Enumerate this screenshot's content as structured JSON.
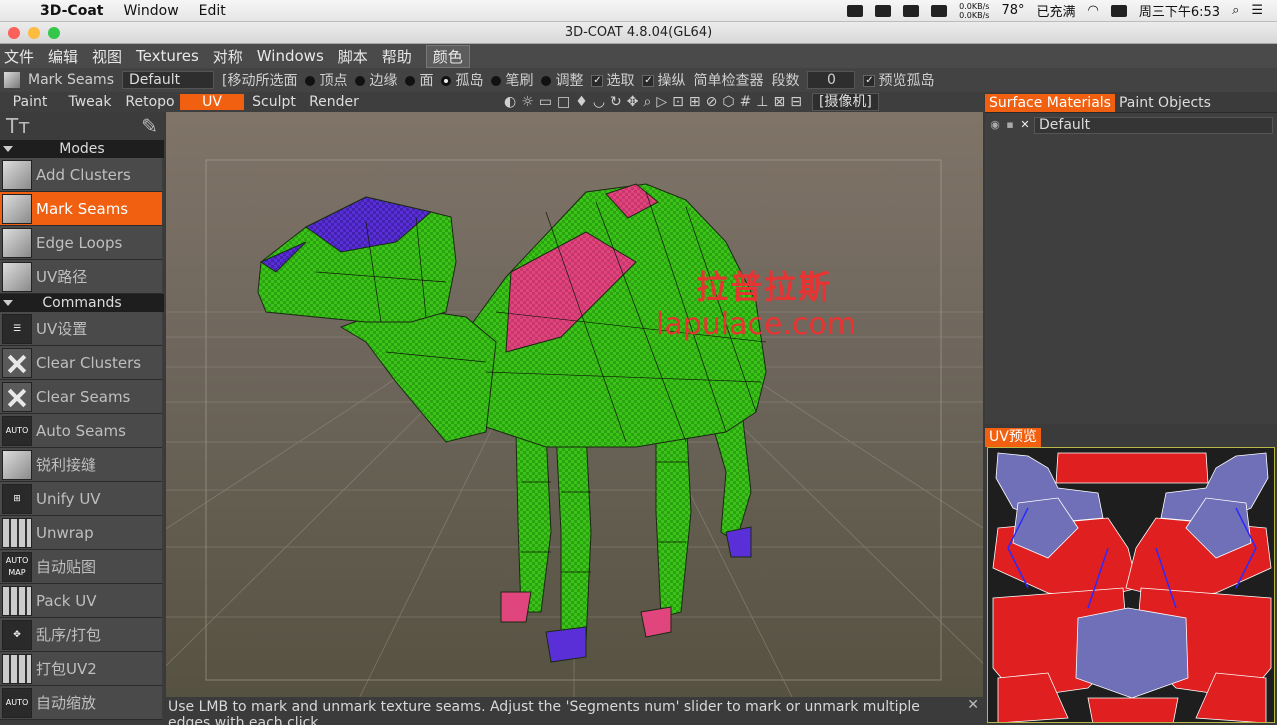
{
  "mac": {
    "app_name": "3D-Coat",
    "menus": [
      "Window",
      "Edit"
    ],
    "net_up": "0.0KB/s",
    "net_down": "0.0KB/s",
    "temp": "78°",
    "battery": "已充满",
    "clock": "周三下午6:53"
  },
  "window": {
    "title": "3D-COAT 4.8.04(GL64)"
  },
  "appmenu": {
    "items": [
      "文件",
      "编辑",
      "视图",
      "Textures",
      "对称",
      "Windows",
      "脚本",
      "帮助"
    ],
    "color_btn": "颜色"
  },
  "toolopts": {
    "tool_label": "Mark Seams",
    "preset": "Default",
    "select_mode": "[移动所选面",
    "vertex": "顶点",
    "edge": "边缘",
    "face": "面",
    "island": "孤岛",
    "brush": "笔刷",
    "adjust": "调整",
    "select_chk": "选取",
    "column_chk": "操纵",
    "simple_check": "简单检查器",
    "segments_label": "段数",
    "segments_value": "0",
    "preview_islands": "预览孤岛"
  },
  "rooms": {
    "tabs": [
      "Paint",
      "Tweak",
      "Retopo",
      "UV",
      "Sculpt",
      "Render"
    ],
    "active": "UV",
    "camera": "[摄像机]"
  },
  "left": {
    "modes_header": "Modes",
    "modes": [
      "Add  Clusters",
      "Mark  Seams",
      "Edge  Loops",
      "UV路径"
    ],
    "active_mode": "Mark  Seams",
    "commands_header": "Commands",
    "commands": [
      "UV设置",
      "Clear  Clusters",
      "Clear  Seams",
      "Auto  Seams",
      "锐利接缝",
      "Unify  UV",
      "Unwrap",
      "自动贴图",
      "Pack  UV",
      "乱序/打包",
      "打包UV2",
      "自动缩放"
    ],
    "auto_label": "AUTO",
    "automap_label": "AUTO MAP"
  },
  "viewport": {
    "watermark_cn": "拉普拉斯",
    "watermark_url": "lapulace.com",
    "status": "Use LMB to mark and unmark texture seams. Adjust the 'Segments num' slider to mark or unmark multiple edges with each click."
  },
  "right": {
    "tabs": [
      "Surface  Materials",
      "Paint  Objects"
    ],
    "active_tab": "Surface  Materials",
    "material": "Default",
    "uv_preview": "UV预览"
  },
  "colors": {
    "accent": "#f06010",
    "mesh_green": "#3cc21a",
    "seam_pink": "#e0457e",
    "seam_blue": "#5a2fd8"
  }
}
